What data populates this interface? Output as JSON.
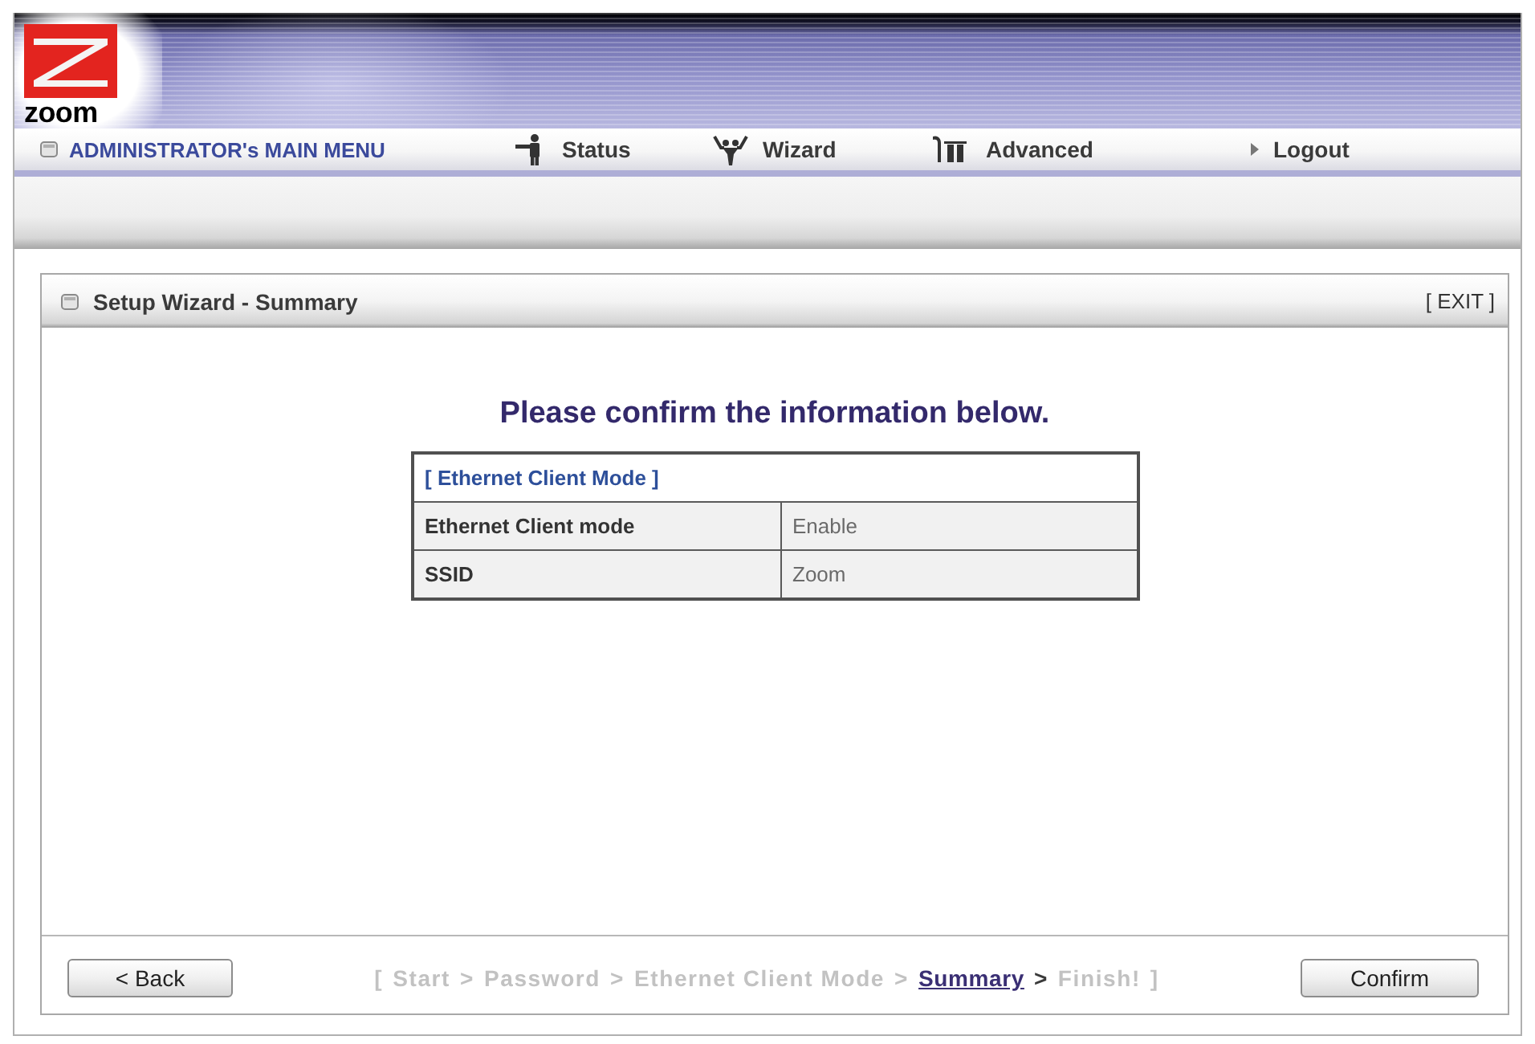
{
  "logo": {
    "text": "zoom"
  },
  "main_menu": {
    "title": "ADMINISTRATOR's MAIN MENU",
    "items": [
      {
        "label": "Status"
      },
      {
        "label": "Wizard"
      },
      {
        "label": "Advanced"
      },
      {
        "label": "Logout"
      }
    ]
  },
  "panel": {
    "title": "Setup Wizard - Summary",
    "exit": "[ EXIT ]"
  },
  "heading": "Please confirm the information below.",
  "summary_table": {
    "section": "[ Ethernet Client Mode ]",
    "rows": [
      {
        "label": "Ethernet Client mode",
        "value": "Enable"
      },
      {
        "label": "SSID",
        "value": "Zoom"
      }
    ]
  },
  "footer": {
    "back": "< Back",
    "progress": {
      "open": "[",
      "steps": [
        {
          "label": "Start",
          "selected": false
        },
        {
          "label": "Password",
          "selected": false
        },
        {
          "label": "Ethernet Client Mode",
          "selected": false
        },
        {
          "label": "Summary",
          "selected": true
        },
        {
          "label": "Finish!",
          "selected": false
        }
      ],
      "separators": [
        ">",
        ">",
        ">",
        ">"
      ],
      "close": "]"
    },
    "confirm": "Confirm"
  }
}
